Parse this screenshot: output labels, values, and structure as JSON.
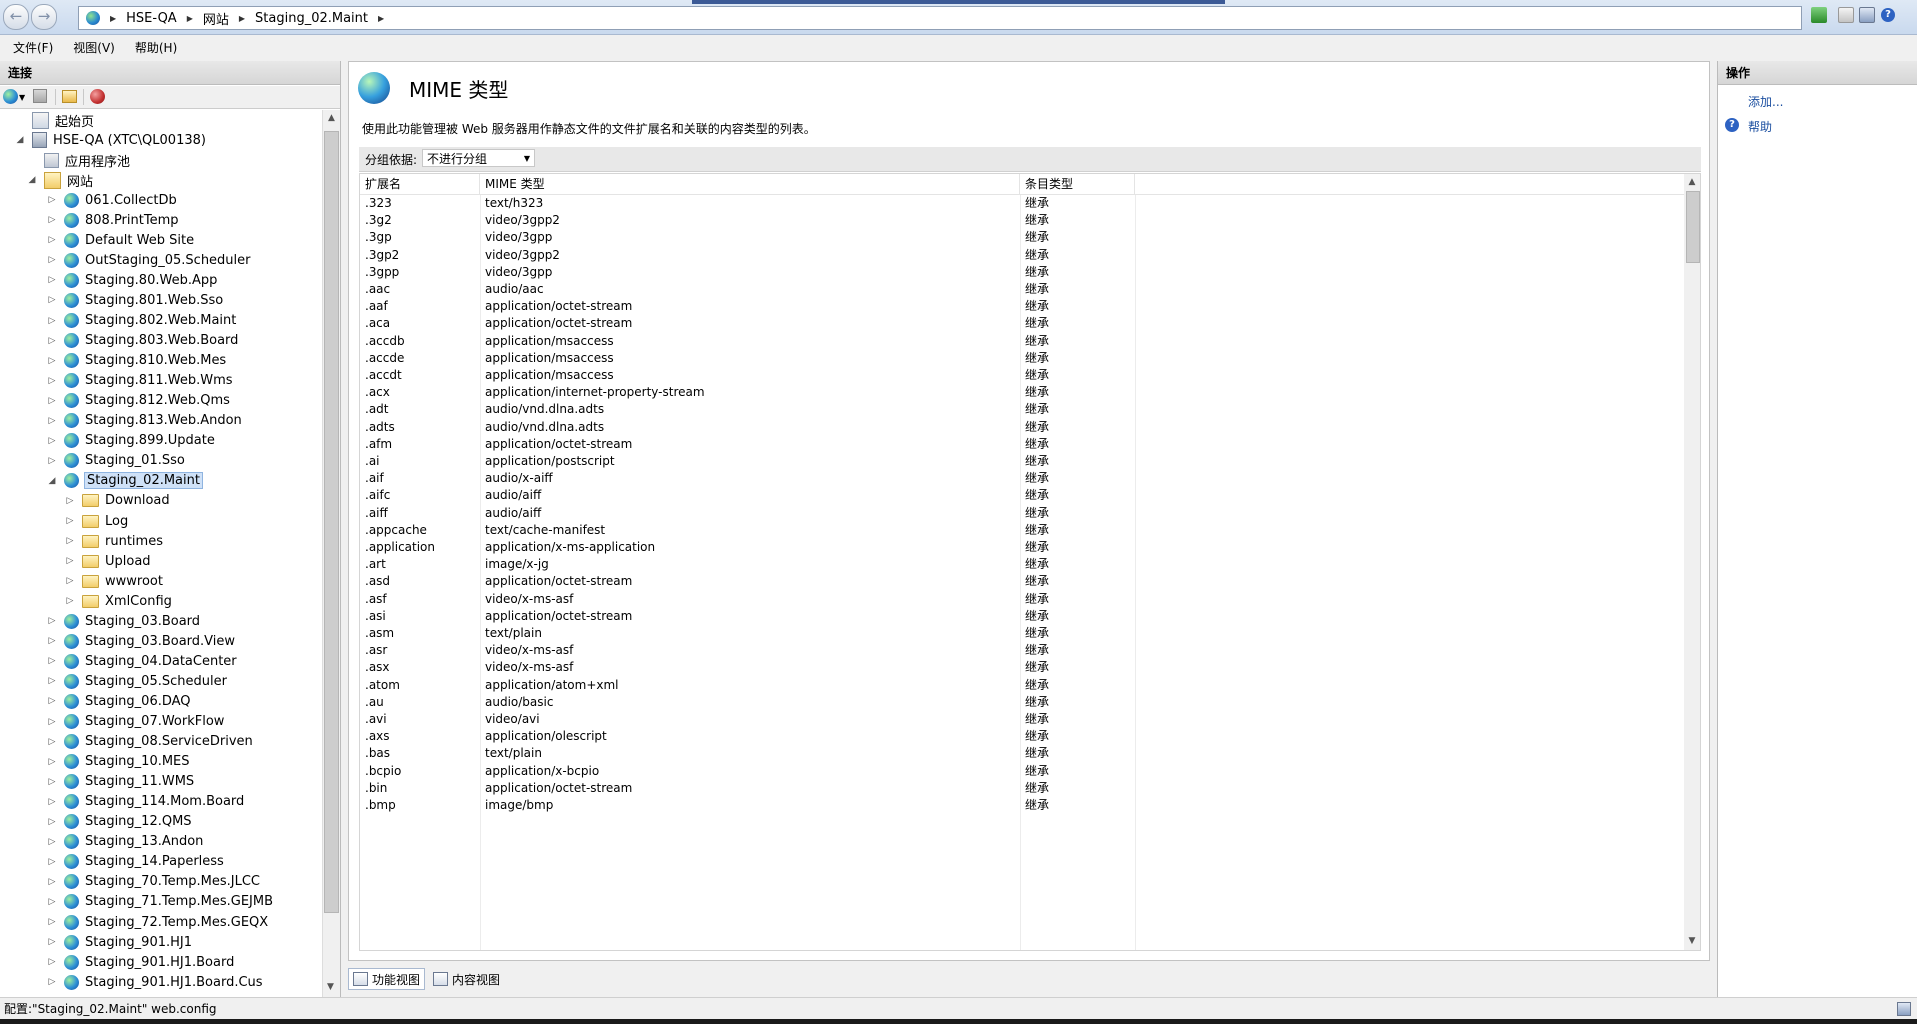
{
  "breadcrumb": [
    "HSE-QA",
    "网站",
    "Staging_02.Maint"
  ],
  "menu": [
    "文件(F)",
    "视图(V)",
    "帮助(H)"
  ],
  "left_panel": {
    "title": "连接",
    "tree": [
      {
        "label": "起始页",
        "icon": "home",
        "level": 0,
        "expander": ""
      },
      {
        "label": "HSE-QA (XTC\\QL00138)",
        "icon": "server",
        "level": 0,
        "expander": "open"
      },
      {
        "label": "应用程序池",
        "icon": "pool",
        "level": 1,
        "expander": ""
      },
      {
        "label": "网站",
        "icon": "site",
        "level": 1,
        "expander": "open"
      },
      {
        "label": "061.CollectDb",
        "icon": "globe",
        "level": 2,
        "expander": "closed"
      },
      {
        "label": "808.PrintTemp",
        "icon": "globe",
        "level": 2,
        "expander": "closed"
      },
      {
        "label": "Default Web Site",
        "icon": "globe",
        "level": 2,
        "expander": "closed"
      },
      {
        "label": "OutStaging_05.Scheduler",
        "icon": "globe",
        "level": 2,
        "expander": "closed"
      },
      {
        "label": "Staging.80.Web.App",
        "icon": "globe",
        "level": 2,
        "expander": "closed"
      },
      {
        "label": "Staging.801.Web.Sso",
        "icon": "globe",
        "level": 2,
        "expander": "closed"
      },
      {
        "label": "Staging.802.Web.Maint",
        "icon": "globe",
        "level": 2,
        "expander": "closed"
      },
      {
        "label": "Staging.803.Web.Board",
        "icon": "globe",
        "level": 2,
        "expander": "closed"
      },
      {
        "label": "Staging.810.Web.Mes",
        "icon": "globe",
        "level": 2,
        "expander": "closed"
      },
      {
        "label": "Staging.811.Web.Wms",
        "icon": "globe",
        "level": 2,
        "expander": "closed"
      },
      {
        "label": "Staging.812.Web.Qms",
        "icon": "globe",
        "level": 2,
        "expander": "closed"
      },
      {
        "label": "Staging.813.Web.Andon",
        "icon": "globe",
        "level": 2,
        "expander": "closed"
      },
      {
        "label": "Staging.899.Update",
        "icon": "globe",
        "level": 2,
        "expander": "closed"
      },
      {
        "label": "Staging_01.Sso",
        "icon": "globe",
        "level": 2,
        "expander": "closed"
      },
      {
        "label": "Staging_02.Maint",
        "icon": "globe",
        "level": 2,
        "expander": "open",
        "selected": true
      },
      {
        "label": "Download",
        "icon": "folder",
        "level": 3,
        "expander": "closed"
      },
      {
        "label": "Log",
        "icon": "folder",
        "level": 3,
        "expander": "closed"
      },
      {
        "label": "runtimes",
        "icon": "folder",
        "level": 3,
        "expander": "closed"
      },
      {
        "label": "Upload",
        "icon": "folder",
        "level": 3,
        "expander": "closed"
      },
      {
        "label": "wwwroot",
        "icon": "folder",
        "level": 3,
        "expander": "closed"
      },
      {
        "label": "XmlConfig",
        "icon": "folder",
        "level": 3,
        "expander": "closed"
      },
      {
        "label": "Staging_03.Board",
        "icon": "globe",
        "level": 2,
        "expander": "closed"
      },
      {
        "label": "Staging_03.Board.View",
        "icon": "globe",
        "level": 2,
        "expander": "closed"
      },
      {
        "label": "Staging_04.DataCenter",
        "icon": "globe",
        "level": 2,
        "expander": "closed"
      },
      {
        "label": "Staging_05.Scheduler",
        "icon": "globe",
        "level": 2,
        "expander": "closed"
      },
      {
        "label": "Staging_06.DAQ",
        "icon": "globe",
        "level": 2,
        "expander": "closed"
      },
      {
        "label": "Staging_07.WorkFlow",
        "icon": "globe",
        "level": 2,
        "expander": "closed"
      },
      {
        "label": "Staging_08.ServiceDriven",
        "icon": "globe",
        "level": 2,
        "expander": "closed"
      },
      {
        "label": "Staging_10.MES",
        "icon": "globe",
        "level": 2,
        "expander": "closed"
      },
      {
        "label": "Staging_11.WMS",
        "icon": "globe",
        "level": 2,
        "expander": "closed"
      },
      {
        "label": "Staging_114.Mom.Board",
        "icon": "globe",
        "level": 2,
        "expander": "closed"
      },
      {
        "label": "Staging_12.QMS",
        "icon": "globe",
        "level": 2,
        "expander": "closed"
      },
      {
        "label": "Staging_13.Andon",
        "icon": "globe",
        "level": 2,
        "expander": "closed"
      },
      {
        "label": "Staging_14.Paperless",
        "icon": "globe",
        "level": 2,
        "expander": "closed"
      },
      {
        "label": "Staging_70.Temp.Mes.JLCC",
        "icon": "globe",
        "level": 2,
        "expander": "closed"
      },
      {
        "label": "Staging_71.Temp.Mes.GEJMB",
        "icon": "globe",
        "level": 2,
        "expander": "closed"
      },
      {
        "label": "Staging_72.Temp.Mes.GEQX",
        "icon": "globe",
        "level": 2,
        "expander": "closed"
      },
      {
        "label": "Staging_901.HJ1",
        "icon": "globe",
        "level": 2,
        "expander": "closed"
      },
      {
        "label": "Staging_901.HJ1.Board",
        "icon": "globe",
        "level": 2,
        "expander": "closed"
      },
      {
        "label": "Staging_901.HJ1.Board.Cus",
        "icon": "globe",
        "level": 2,
        "expander": "closed"
      }
    ]
  },
  "main": {
    "title": "MIME 类型",
    "description": "使用此功能管理被 Web 服务器用作静态文件的文件扩展名和关联的内容类型的列表。",
    "group_label": "分组依据:",
    "group_value": "不进行分组",
    "columns": [
      "扩展名",
      "MIME 类型",
      "条目类型"
    ],
    "rows": [
      [
        ".323",
        "text/h323",
        "继承"
      ],
      [
        ".3g2",
        "video/3gpp2",
        "继承"
      ],
      [
        ".3gp",
        "video/3gpp",
        "继承"
      ],
      [
        ".3gp2",
        "video/3gpp2",
        "继承"
      ],
      [
        ".3gpp",
        "video/3gpp",
        "继承"
      ],
      [
        ".aac",
        "audio/aac",
        "继承"
      ],
      [
        ".aaf",
        "application/octet-stream",
        "继承"
      ],
      [
        ".aca",
        "application/octet-stream",
        "继承"
      ],
      [
        ".accdb",
        "application/msaccess",
        "继承"
      ],
      [
        ".accde",
        "application/msaccess",
        "继承"
      ],
      [
        ".accdt",
        "application/msaccess",
        "继承"
      ],
      [
        ".acx",
        "application/internet-property-stream",
        "继承"
      ],
      [
        ".adt",
        "audio/vnd.dlna.adts",
        "继承"
      ],
      [
        ".adts",
        "audio/vnd.dlna.adts",
        "继承"
      ],
      [
        ".afm",
        "application/octet-stream",
        "继承"
      ],
      [
        ".ai",
        "application/postscript",
        "继承"
      ],
      [
        ".aif",
        "audio/x-aiff",
        "继承"
      ],
      [
        ".aifc",
        "audio/aiff",
        "继承"
      ],
      [
        ".aiff",
        "audio/aiff",
        "继承"
      ],
      [
        ".appcache",
        "text/cache-manifest",
        "继承"
      ],
      [
        ".application",
        "application/x-ms-application",
        "继承"
      ],
      [
        ".art",
        "image/x-jg",
        "继承"
      ],
      [
        ".asd",
        "application/octet-stream",
        "继承"
      ],
      [
        ".asf",
        "video/x-ms-asf",
        "继承"
      ],
      [
        ".asi",
        "application/octet-stream",
        "继承"
      ],
      [
        ".asm",
        "text/plain",
        "继承"
      ],
      [
        ".asr",
        "video/x-ms-asf",
        "继承"
      ],
      [
        ".asx",
        "video/x-ms-asf",
        "继承"
      ],
      [
        ".atom",
        "application/atom+xml",
        "继承"
      ],
      [
        ".au",
        "audio/basic",
        "继承"
      ],
      [
        ".avi",
        "video/avi",
        "继承"
      ],
      [
        ".axs",
        "application/olescript",
        "继承"
      ],
      [
        ".bas",
        "text/plain",
        "继承"
      ],
      [
        ".bcpio",
        "application/x-bcpio",
        "继承"
      ],
      [
        ".bin",
        "application/octet-stream",
        "继承"
      ],
      [
        ".bmp",
        "image/bmp",
        "继承"
      ]
    ]
  },
  "view_tabs": [
    "功能视图",
    "内容视图"
  ],
  "right_panel": {
    "title": "操作",
    "actions": [
      "添加...",
      "帮助"
    ]
  },
  "status": "配置:\"Staging_02.Maint\" web.config",
  "colors": {
    "selection": "#cfe1f7",
    "link": "#1c4fa0"
  }
}
